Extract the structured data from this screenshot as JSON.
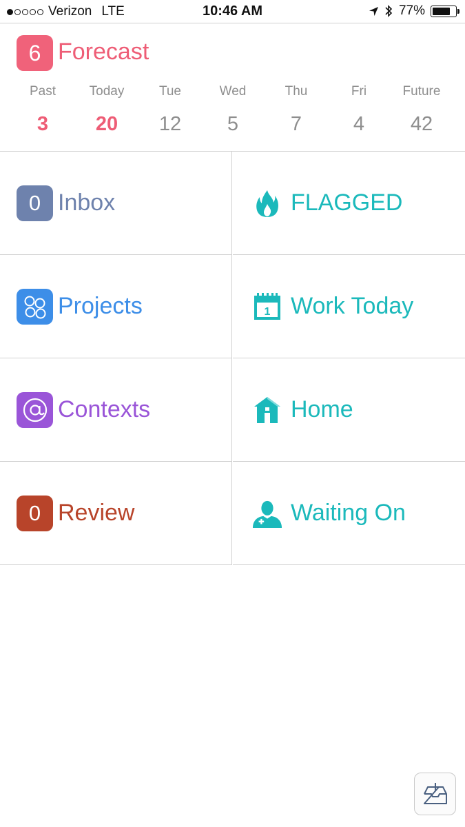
{
  "status_bar": {
    "carrier": "Verizon",
    "network": "LTE",
    "time": "10:46 AM",
    "battery_text": "77%",
    "battery_level": 0.77,
    "signal_bars_filled": 1,
    "signal_bars_total": 5
  },
  "forecast": {
    "badge": "6",
    "title": "Forecast",
    "color": "#ee5d76",
    "days": [
      {
        "label": "Past",
        "count": "3",
        "highlight": true
      },
      {
        "label": "Today",
        "count": "20",
        "highlight": true
      },
      {
        "label": "Tue",
        "count": "12",
        "highlight": false
      },
      {
        "label": "Wed",
        "count": "5",
        "highlight": false
      },
      {
        "label": "Thu",
        "count": "7",
        "highlight": false
      },
      {
        "label": "Fri",
        "count": "4",
        "highlight": false
      },
      {
        "label": "Future",
        "count": "42",
        "highlight": false
      }
    ]
  },
  "perspectives": {
    "inbox": {
      "badge": "0",
      "label": "Inbox",
      "color": "#6e82ad"
    },
    "projects": {
      "label": "Projects",
      "color": "#3d8ee8",
      "icon": "projects-circles-icon"
    },
    "contexts": {
      "label": "Contexts",
      "color": "#9a55d8",
      "icon": "at-sign-icon"
    },
    "review": {
      "badge": "0",
      "label": "Review",
      "color": "#b8442a"
    },
    "flagged": {
      "label": "FLAGGED",
      "color": "#1bb9bb",
      "icon": "flame-icon"
    },
    "work_today": {
      "label": "Work Today",
      "color": "#1bb9bb",
      "icon": "calendar-icon",
      "icon_text": "1"
    },
    "home": {
      "label": "Home",
      "color": "#1bb9bb",
      "icon": "house-icon"
    },
    "waiting_on": {
      "label": "Waiting On",
      "color": "#1bb9bb",
      "icon": "person-icon"
    }
  },
  "quick_entry": {
    "icon": "inbox-add-icon"
  }
}
